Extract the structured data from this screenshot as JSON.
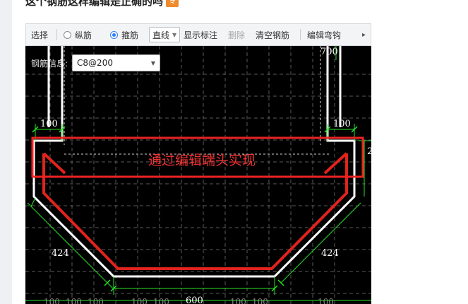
{
  "page": {
    "title": "这个钢筋这样编辑是正确的吗",
    "badge": "专"
  },
  "toolbar": {
    "select": "选择",
    "longitudinal": "纵筋",
    "stirrup": "箍筋",
    "line_mode": "直线",
    "show_dims": "显示标注",
    "delete": "删除",
    "clear": "清空钢筋",
    "edit_hook": "编辑弯钩",
    "more": "▸"
  },
  "canvas": {
    "info_label": "钢筋信息:",
    "info_value": "C8@200",
    "annotation": "通过编辑端头实现",
    "dims": {
      "top_right": "700",
      "left_100": "100",
      "right_100": "100",
      "left_424": "424",
      "right_424": "424",
      "bottom_600": "600",
      "edge_right": "2",
      "grid_100": "100"
    }
  },
  "colors": {
    "canvas_bg": "#000000",
    "dim_green": "#27e327",
    "rebar_red": "#e0231c",
    "outline_white": "#ffffff",
    "annotation_red": "#ee2222"
  }
}
